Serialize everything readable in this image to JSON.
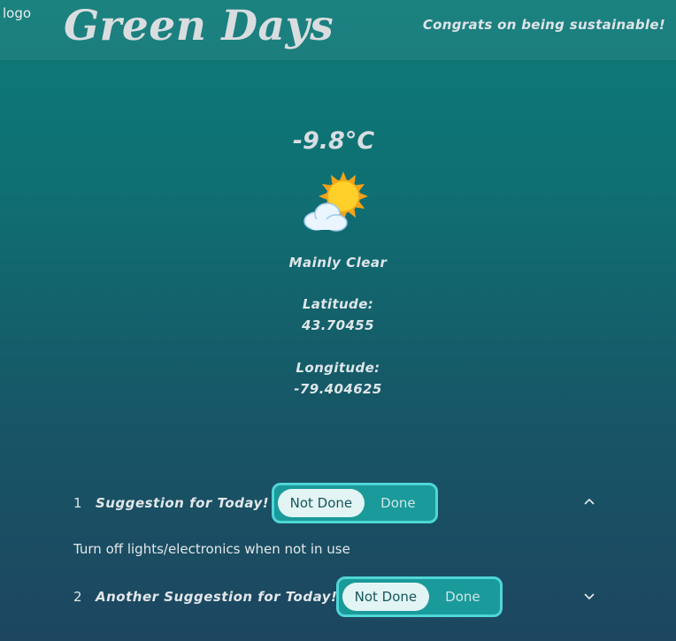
{
  "header": {
    "logo_alt": "logo",
    "title": "Green Days",
    "tagline": "Congrats on being sustainable!"
  },
  "weather": {
    "temperature": "-9.8°C",
    "icon": "sun-behind-cloud-icon",
    "condition": "Mainly Clear",
    "latitude_label": "Latitude:",
    "latitude_value": "43.70455",
    "longitude_label": "Longitude:",
    "longitude_value": "-79.404625"
  },
  "suggestions": [
    {
      "number": "1",
      "title": "Suggestion for Today!",
      "toggle": {
        "not_done": "Not Done",
        "done": "Done",
        "selected": "Not Done"
      },
      "expanded": true,
      "detail": "Turn off lights/electronics when not in use"
    },
    {
      "number": "2",
      "title": "Another Suggestion for Today!",
      "toggle": {
        "not_done": "Not Done",
        "done": "Done",
        "selected": "Not Done"
      },
      "expanded": false
    }
  ]
}
